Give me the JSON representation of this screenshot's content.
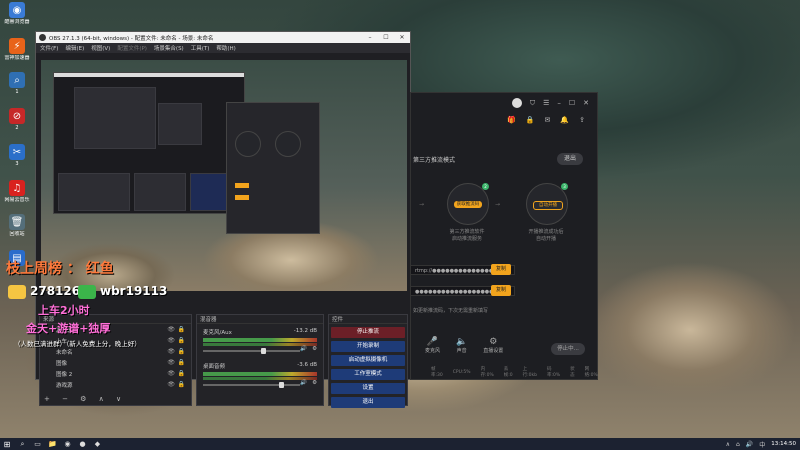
{
  "desktop": {
    "icons": [
      {
        "label": "酷睿浏览器",
        "color": "#3a7bd5"
      },
      {
        "label": "雷神加速器",
        "color": "#e8631a"
      },
      {
        "label": "1",
        "color": "#2f6fb3"
      },
      {
        "label": "2",
        "color": "#c62828"
      },
      {
        "label": "3",
        "color": "#2b6fc9"
      },
      {
        "label": "网易云音乐",
        "color": "#d9221f"
      },
      {
        "label": "回收站",
        "color": "#546e7a"
      },
      {
        "label": "",
        "color": "#2a6ccb"
      }
    ]
  },
  "obs": {
    "title": "OBS 27.1.3 (64-bit, windows) - 配置文件: 未命名 - 场景: 未命名",
    "menu": [
      "文件(F)",
      "编辑(E)",
      "视图(V)",
      "配置文件(P)",
      "场景集合(S)",
      "工具(T)",
      "帮助(H)"
    ],
    "overlay": {
      "rank_text": "枝上周榜  ： 红鱼",
      "qq_number": "278126",
      "wx_text": "wbr19113",
      "line1": "上车2小时",
      "line2": "金天+游谱+独厚",
      "note": "（人数已满进群）（新人免费上分，晚上好）"
    },
    "sources": {
      "header": "来源",
      "items": [
        "游戏源",
        "上车",
        "未命名",
        "图像",
        "图像 2",
        "游戏源"
      ]
    },
    "mixer": {
      "header": "混音器",
      "channels": [
        {
          "name": "麦克风/Aux",
          "db": "-13.2 dB"
        },
        {
          "name": "桌面音频",
          "db": "-3.6 dB"
        }
      ]
    },
    "controls": {
      "header": "控件",
      "buttons": [
        "停止推流",
        "开始录制",
        "启动虚拟摄像机",
        "工作室模式",
        "设置",
        "退出"
      ]
    }
  },
  "app": {
    "mode_label": "第三方推流模式",
    "exit_label": "退出",
    "step1": {
      "badge": "2",
      "pill": "获取推流码",
      "caption": "第三方推流软件\n启动推流服务"
    },
    "step2": {
      "badge": "3",
      "pill": "自动开播",
      "caption": "开播推流成功后\n自动开播"
    },
    "server_field": "rtmp://●●●●●●●●●●●●●●●●",
    "key_field": "●●●●●●●●●●●●●●●●●●●●●",
    "copy_label": "复制",
    "tip": "如更新推流码，下次无需重新填写",
    "tools": [
      "麦克风",
      "声音",
      "直播设置"
    ],
    "live_button": "停止中...",
    "status_items": [
      "帧率:30",
      "CPU:5%",
      "内存:0%",
      "丢帧:0",
      "上行:0kb",
      "码率:0%",
      "状态",
      "网络:0%"
    ]
  },
  "taskbar": {
    "clock": "13:14:50",
    "tray_lang": "中"
  }
}
